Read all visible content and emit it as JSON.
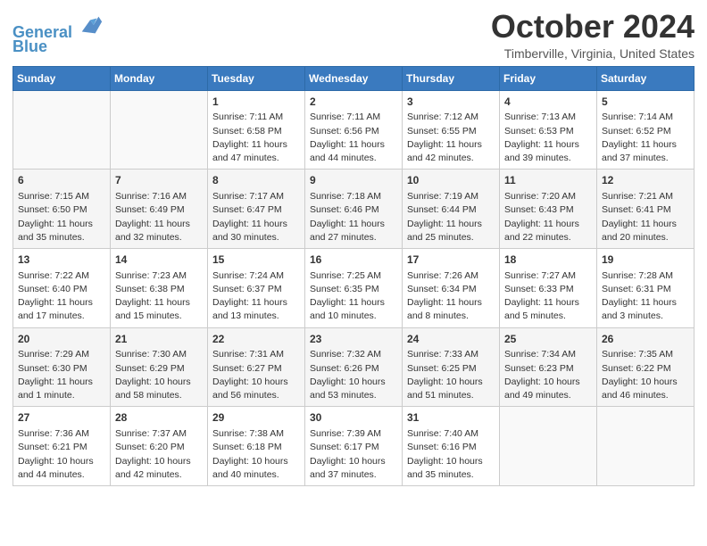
{
  "header": {
    "logo_line1": "General",
    "logo_line2": "Blue",
    "title": "October 2024",
    "subtitle": "Timberville, Virginia, United States"
  },
  "weekdays": [
    "Sunday",
    "Monday",
    "Tuesday",
    "Wednesday",
    "Thursday",
    "Friday",
    "Saturday"
  ],
  "weeks": [
    [
      {
        "day": "",
        "info": ""
      },
      {
        "day": "",
        "info": ""
      },
      {
        "day": "1",
        "info": "Sunrise: 7:11 AM\nSunset: 6:58 PM\nDaylight: 11 hours and 47 minutes."
      },
      {
        "day": "2",
        "info": "Sunrise: 7:11 AM\nSunset: 6:56 PM\nDaylight: 11 hours and 44 minutes."
      },
      {
        "day": "3",
        "info": "Sunrise: 7:12 AM\nSunset: 6:55 PM\nDaylight: 11 hours and 42 minutes."
      },
      {
        "day": "4",
        "info": "Sunrise: 7:13 AM\nSunset: 6:53 PM\nDaylight: 11 hours and 39 minutes."
      },
      {
        "day": "5",
        "info": "Sunrise: 7:14 AM\nSunset: 6:52 PM\nDaylight: 11 hours and 37 minutes."
      }
    ],
    [
      {
        "day": "6",
        "info": "Sunrise: 7:15 AM\nSunset: 6:50 PM\nDaylight: 11 hours and 35 minutes."
      },
      {
        "day": "7",
        "info": "Sunrise: 7:16 AM\nSunset: 6:49 PM\nDaylight: 11 hours and 32 minutes."
      },
      {
        "day": "8",
        "info": "Sunrise: 7:17 AM\nSunset: 6:47 PM\nDaylight: 11 hours and 30 minutes."
      },
      {
        "day": "9",
        "info": "Sunrise: 7:18 AM\nSunset: 6:46 PM\nDaylight: 11 hours and 27 minutes."
      },
      {
        "day": "10",
        "info": "Sunrise: 7:19 AM\nSunset: 6:44 PM\nDaylight: 11 hours and 25 minutes."
      },
      {
        "day": "11",
        "info": "Sunrise: 7:20 AM\nSunset: 6:43 PM\nDaylight: 11 hours and 22 minutes."
      },
      {
        "day": "12",
        "info": "Sunrise: 7:21 AM\nSunset: 6:41 PM\nDaylight: 11 hours and 20 minutes."
      }
    ],
    [
      {
        "day": "13",
        "info": "Sunrise: 7:22 AM\nSunset: 6:40 PM\nDaylight: 11 hours and 17 minutes."
      },
      {
        "day": "14",
        "info": "Sunrise: 7:23 AM\nSunset: 6:38 PM\nDaylight: 11 hours and 15 minutes."
      },
      {
        "day": "15",
        "info": "Sunrise: 7:24 AM\nSunset: 6:37 PM\nDaylight: 11 hours and 13 minutes."
      },
      {
        "day": "16",
        "info": "Sunrise: 7:25 AM\nSunset: 6:35 PM\nDaylight: 11 hours and 10 minutes."
      },
      {
        "day": "17",
        "info": "Sunrise: 7:26 AM\nSunset: 6:34 PM\nDaylight: 11 hours and 8 minutes."
      },
      {
        "day": "18",
        "info": "Sunrise: 7:27 AM\nSunset: 6:33 PM\nDaylight: 11 hours and 5 minutes."
      },
      {
        "day": "19",
        "info": "Sunrise: 7:28 AM\nSunset: 6:31 PM\nDaylight: 11 hours and 3 minutes."
      }
    ],
    [
      {
        "day": "20",
        "info": "Sunrise: 7:29 AM\nSunset: 6:30 PM\nDaylight: 11 hours and 1 minute."
      },
      {
        "day": "21",
        "info": "Sunrise: 7:30 AM\nSunset: 6:29 PM\nDaylight: 10 hours and 58 minutes."
      },
      {
        "day": "22",
        "info": "Sunrise: 7:31 AM\nSunset: 6:27 PM\nDaylight: 10 hours and 56 minutes."
      },
      {
        "day": "23",
        "info": "Sunrise: 7:32 AM\nSunset: 6:26 PM\nDaylight: 10 hours and 53 minutes."
      },
      {
        "day": "24",
        "info": "Sunrise: 7:33 AM\nSunset: 6:25 PM\nDaylight: 10 hours and 51 minutes."
      },
      {
        "day": "25",
        "info": "Sunrise: 7:34 AM\nSunset: 6:23 PM\nDaylight: 10 hours and 49 minutes."
      },
      {
        "day": "26",
        "info": "Sunrise: 7:35 AM\nSunset: 6:22 PM\nDaylight: 10 hours and 46 minutes."
      }
    ],
    [
      {
        "day": "27",
        "info": "Sunrise: 7:36 AM\nSunset: 6:21 PM\nDaylight: 10 hours and 44 minutes."
      },
      {
        "day": "28",
        "info": "Sunrise: 7:37 AM\nSunset: 6:20 PM\nDaylight: 10 hours and 42 minutes."
      },
      {
        "day": "29",
        "info": "Sunrise: 7:38 AM\nSunset: 6:18 PM\nDaylight: 10 hours and 40 minutes."
      },
      {
        "day": "30",
        "info": "Sunrise: 7:39 AM\nSunset: 6:17 PM\nDaylight: 10 hours and 37 minutes."
      },
      {
        "day": "31",
        "info": "Sunrise: 7:40 AM\nSunset: 6:16 PM\nDaylight: 10 hours and 35 minutes."
      },
      {
        "day": "",
        "info": ""
      },
      {
        "day": "",
        "info": ""
      }
    ]
  ]
}
